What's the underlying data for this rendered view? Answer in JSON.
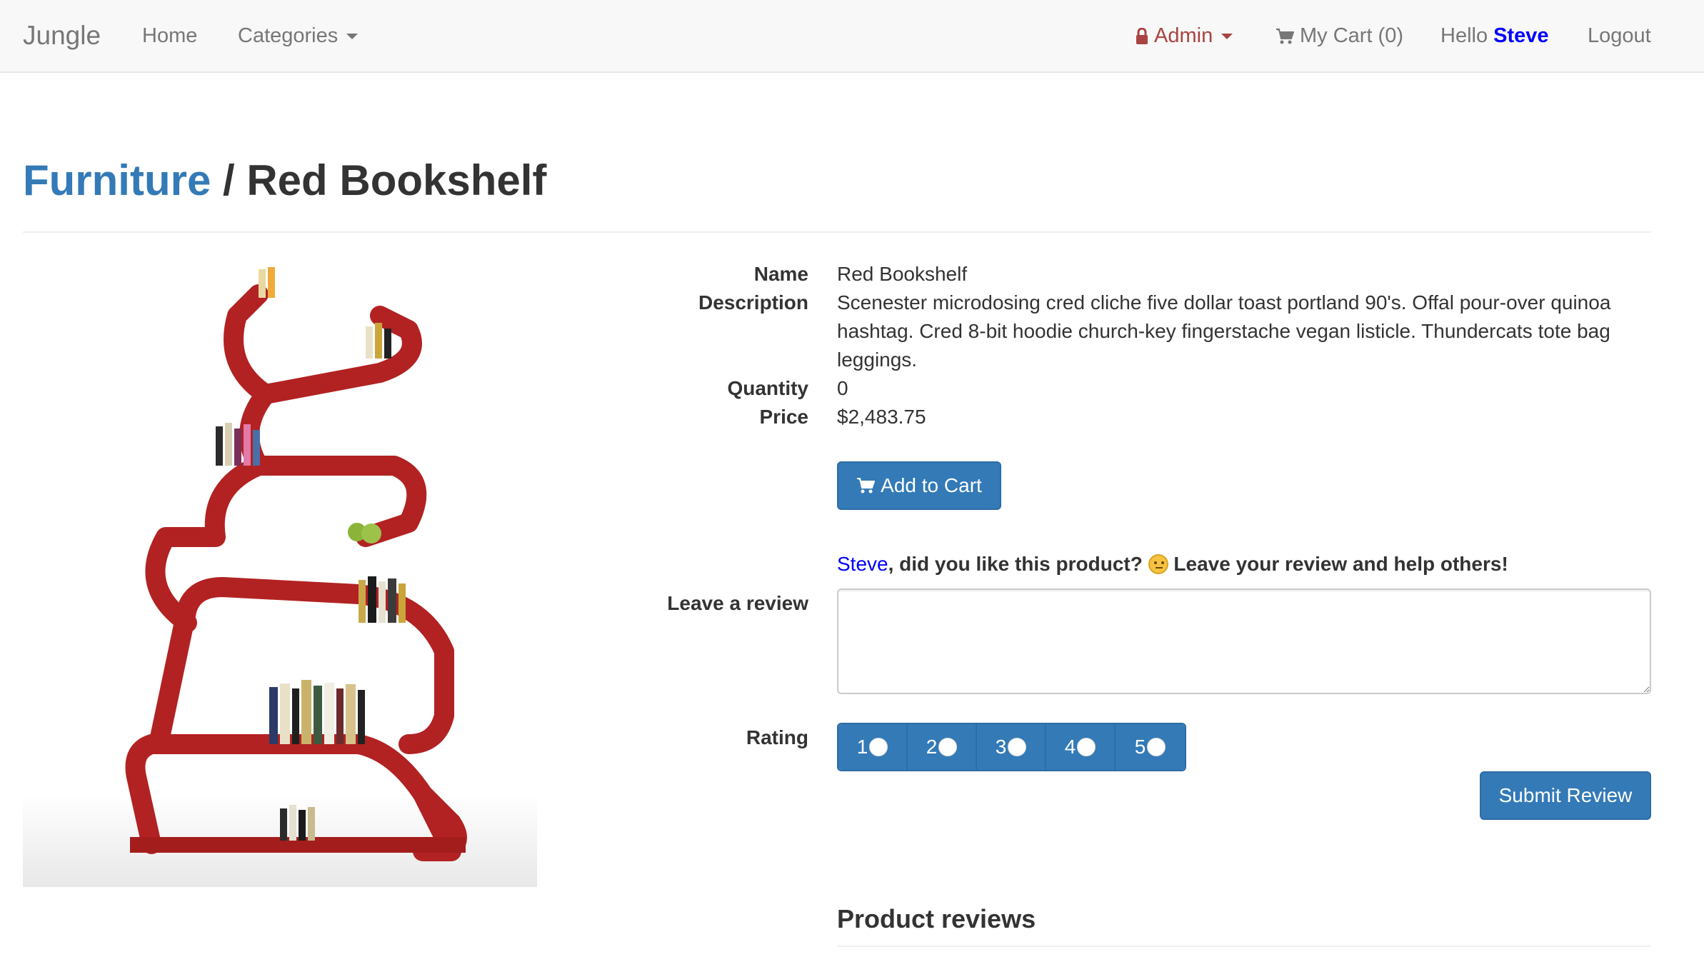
{
  "navbar": {
    "brand": "Jungle",
    "home": "Home",
    "categories": "Categories",
    "admin": "Admin",
    "cart": "My Cart (0)",
    "hello": "Hello",
    "user": "Steve",
    "logout": "Logout"
  },
  "header": {
    "category": "Furniture",
    "separator": " / ",
    "product": "Red Bookshelf"
  },
  "details": {
    "name_label": "Name",
    "name_value": "Red Bookshelf",
    "description_label": "Description",
    "description_value": "Scenester microdosing cred cliche five dollar toast portland 90's. Offal pour-over quinoa hashtag. Cred 8-bit hoodie church-key fingerstache vegan listicle. Thundercats tote bag leggings.",
    "quantity_label": "Quantity",
    "quantity_value": "0",
    "price_label": "Price",
    "price_value": "$2,483.75"
  },
  "actions": {
    "add_to_cart": "Add to Cart",
    "submit_review": "Submit Review"
  },
  "review": {
    "prompt_name": "Steve",
    "prompt_text": ", did you like this product? ",
    "prompt_tail": " Leave your review and help others!",
    "leave_label": "Leave a review",
    "rating_label": "Rating",
    "ratings": [
      "1",
      "2",
      "3",
      "4",
      "5"
    ]
  },
  "reviews": {
    "heading": "Product reviews"
  },
  "colors": {
    "link": "#337ab7",
    "primary": "#337ab7",
    "admin": "#a94442",
    "user": "#0000ff",
    "shelf": "#b22222"
  }
}
